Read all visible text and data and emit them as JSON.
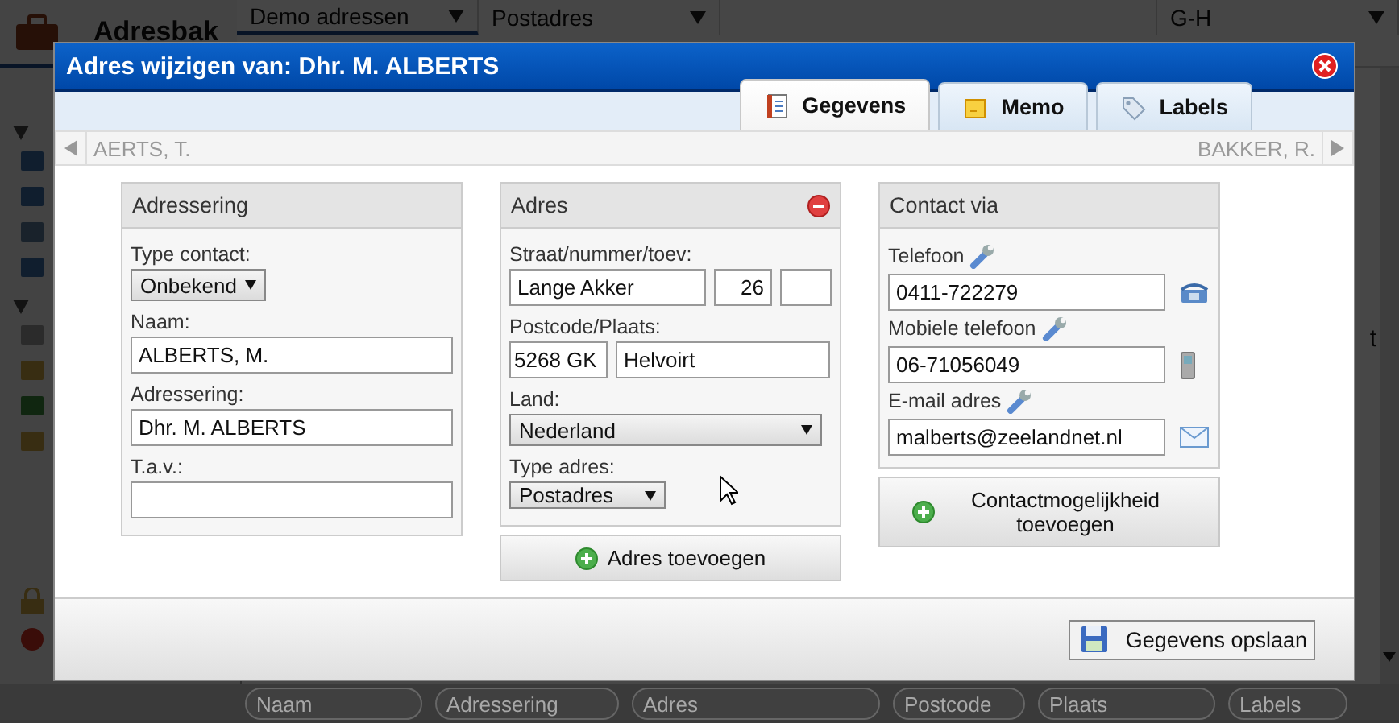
{
  "app": {
    "title": "Adresbak",
    "filters": [
      {
        "label": "Demo adressen"
      },
      {
        "label": "Postadres"
      },
      {
        "label": "G-H"
      }
    ],
    "list_text": "t",
    "search_fields": [
      {
        "placeholder": "Naam"
      },
      {
        "placeholder": "Adressering"
      },
      {
        "placeholder": "Adres"
      },
      {
        "placeholder": "Postcode"
      },
      {
        "placeholder": "Plaats"
      },
      {
        "placeholder": "Labels"
      }
    ]
  },
  "dialog": {
    "title": "Adres wijzigen van: Dhr. M. ALBERTS",
    "tabs": [
      {
        "label": "Gegevens",
        "kind": "notebook",
        "selected": true
      },
      {
        "label": "Memo",
        "kind": "note",
        "selected": false
      },
      {
        "label": "Labels",
        "kind": "tag",
        "selected": false
      }
    ],
    "nav": {
      "previous": "AERTS, T.",
      "next": "BAKKER, R."
    },
    "adressering": {
      "heading": "Adressering",
      "type_label": "Type contact:",
      "type_value": "Onbekend",
      "name_label": "Naam:",
      "name_value": "ALBERTS, M.",
      "addr_label": "Adressering:",
      "addr_value": "Dhr. M. ALBERTS",
      "tav_label": "T.a.v.:"
    },
    "adres": {
      "heading": "Adres",
      "street_label": "Straat/nummer/toev:",
      "street": "Lange Akker",
      "number": "26",
      "postal_label": "Postcode/Plaats:",
      "postcode": "5268 GK",
      "city": "Helvoirt",
      "country_label": "Land:",
      "country": "Nederland",
      "type_label": "Type adres:",
      "type_value": "Postadres",
      "add_button": "Adres toevoegen"
    },
    "contact": {
      "heading": "Contact via",
      "items": [
        {
          "label": "Telefoon",
          "value": "0411-722279",
          "kind": "phone"
        },
        {
          "label": "Mobiele telefoon",
          "value": "06-71056049",
          "kind": "mobile"
        },
        {
          "label": "E-mail adres",
          "value": "malberts@zeelandnet.nl",
          "kind": "email"
        }
      ],
      "add_button": "Contactmogelijkheid toevoegen"
    },
    "save_button": "Gegevens opslaan"
  }
}
